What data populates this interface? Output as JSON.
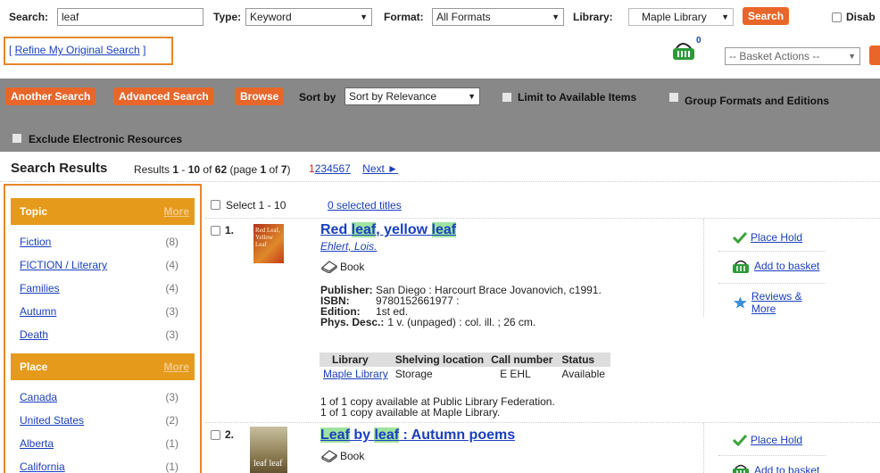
{
  "search": {
    "label": "Search:",
    "value": "leaf"
  },
  "type": {
    "label": "Type:",
    "value": "Keyword"
  },
  "format": {
    "label": "Format:",
    "value": "All Formats"
  },
  "library": {
    "label": "Library:",
    "value": "Maple Library"
  },
  "search_button": "Search",
  "disable_label": "Disab",
  "refine_link": "Refine My Original Search",
  "basket": {
    "count": "0",
    "actions": "-- Basket Actions --"
  },
  "toolbar": {
    "another": "Another Search",
    "advanced": "Advanced Search",
    "browse": "Browse",
    "sort_label": "Sort by",
    "sort_value": "Sort by Relevance",
    "limit": "Limit to Available Items",
    "group": "Group Formats and Editions",
    "exclude": "Exclude Electronic Resources"
  },
  "results_header": {
    "title": "Search Results",
    "pre": "Results",
    "range_start": "1",
    "range_sep": " - ",
    "range_end": "10",
    "of": " of ",
    "total": "62",
    "page_pre": " (page ",
    "page": "1",
    "page_of": " of ",
    "pages": "7",
    "page_post": ")",
    "current_page": "1",
    "page_links": [
      "2",
      "3",
      "4",
      "5",
      "6",
      "7"
    ],
    "next": "Next ►"
  },
  "select_all": "Select 1 - 10",
  "selected_titles": "0 selected titles",
  "facets": [
    {
      "title": "Topic",
      "more": "More",
      "items": [
        {
          "label": "Fiction",
          "count": "(8)"
        },
        {
          "label": "FICTION / Literary",
          "count": "(4)"
        },
        {
          "label": "Families",
          "count": "(4)"
        },
        {
          "label": "Autumn",
          "count": "(3)"
        },
        {
          "label": "Death",
          "count": "(3)"
        }
      ]
    },
    {
      "title": "Place",
      "more": "More",
      "items": [
        {
          "label": "Canada",
          "count": "(3)"
        },
        {
          "label": "United States",
          "count": "(2)"
        },
        {
          "label": "Alberta",
          "count": "(1)"
        },
        {
          "label": "California",
          "count": "(1)"
        }
      ]
    }
  ],
  "results": [
    {
      "num": "1.",
      "title_parts": [
        "Red ",
        "leaf",
        ", yellow ",
        "leaf"
      ],
      "author": "Ehlert, Lois.",
      "format": "Book",
      "cover_text": "Red Leaf, Yellow Leaf",
      "publisher_label": "Publisher:",
      "publisher": "San Diego : Harcourt Brace Jovanovich, c1991.",
      "isbn_label": "ISBN:",
      "isbn": "9780152661977 :",
      "edition_label": "Edition:",
      "edition": "1st ed.",
      "phys_label": "Phys. Desc.:",
      "phys": "1 v. (unpaged) : col. ill. ; 26 cm.",
      "holdings_headers": [
        "Library",
        "Shelving location",
        "Call number",
        "Status"
      ],
      "holdings": [
        "Maple Library",
        "Storage",
        "E EHL",
        "Available"
      ],
      "avail1": "1 of 1 copy available at Public Library Federation.",
      "avail2": "1 of 1 copy available at Maple Library.",
      "actions": [
        "Place Hold",
        "Add to basket",
        "Reviews & More"
      ]
    },
    {
      "num": "2.",
      "title_parts": [
        "Leaf",
        " by ",
        "leaf",
        " : Autumn poems"
      ],
      "format": "Book",
      "cover_text": "leaf leaf",
      "actions": [
        "Place Hold",
        "Add to basket"
      ]
    }
  ],
  "colors": {
    "orange": "#e8662a",
    "facet": "#e59a1b",
    "gray_bar": "#888888",
    "link": "#1a3fbf",
    "highlight": "#9fe3a0"
  }
}
